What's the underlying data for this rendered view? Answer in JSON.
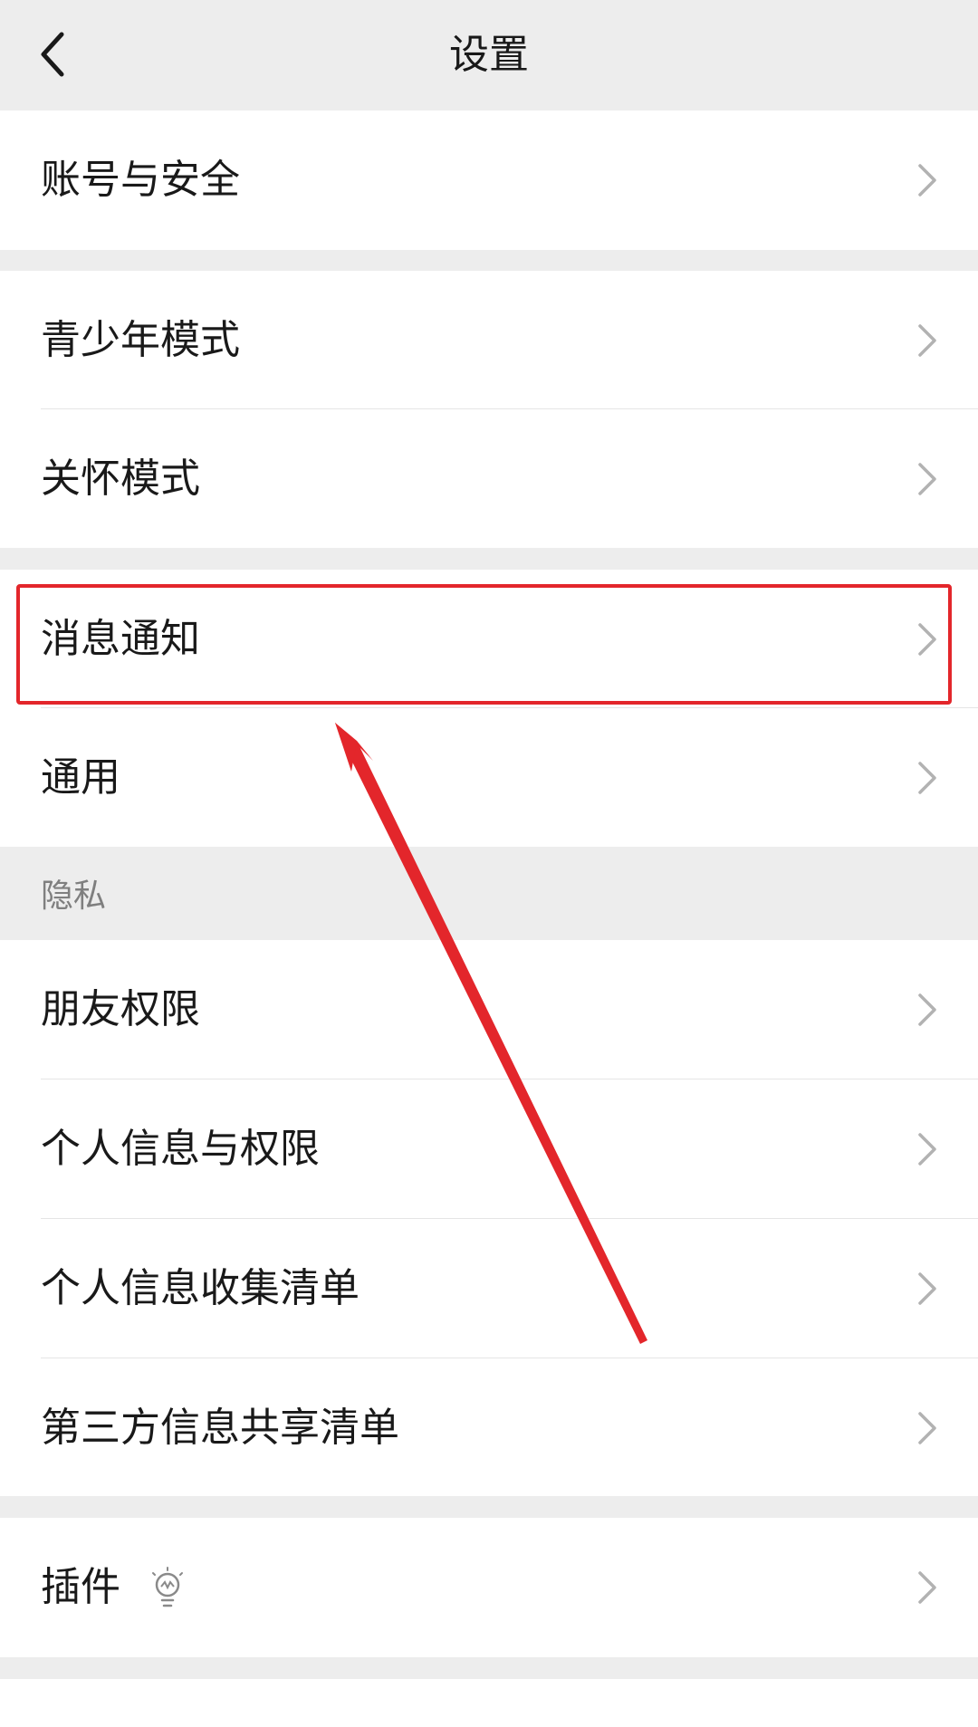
{
  "header": {
    "title": "设置",
    "back_icon": "chevron-left-icon"
  },
  "groups": {
    "account": {
      "items": [
        {
          "label": "账号与安全"
        }
      ]
    },
    "modes": {
      "items": [
        {
          "label": "青少年模式"
        },
        {
          "label": "关怀模式"
        }
      ]
    },
    "general": {
      "items": [
        {
          "label": "消息通知"
        },
        {
          "label": "通用"
        }
      ]
    },
    "privacy": {
      "title": "隐私",
      "items": [
        {
          "label": "朋友权限"
        },
        {
          "label": "个人信息与权限"
        },
        {
          "label": "个人信息收集清单"
        },
        {
          "label": "第三方信息共享清单"
        }
      ]
    },
    "plugins": {
      "items": [
        {
          "label": "插件",
          "icon": "lightbulb-icon"
        }
      ]
    }
  },
  "annotation": {
    "highlighted_item": "消息通知",
    "color": "#e3262b"
  },
  "colors": {
    "background": "#ededed",
    "row": "#ffffff",
    "text": "#191919",
    "section_title": "#7f7f7f",
    "chevron": "#b2b2b2"
  }
}
